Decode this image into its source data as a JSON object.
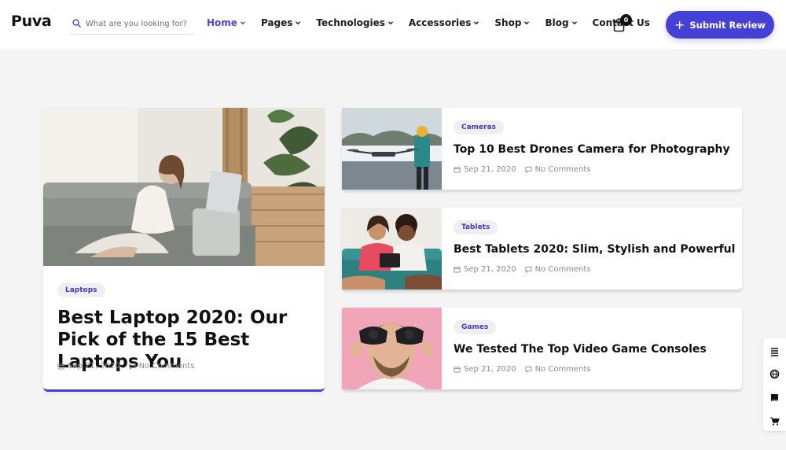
{
  "header": {
    "logo": "Puva",
    "search": {
      "placeholder": "What are you looking for?",
      "value": ""
    },
    "nav": [
      {
        "label": "Home",
        "dropdown": true,
        "active": true
      },
      {
        "label": "Pages",
        "dropdown": true
      },
      {
        "label": "Technologies",
        "dropdown": true
      },
      {
        "label": "Accessories",
        "dropdown": true
      },
      {
        "label": "Shop",
        "dropdown": true
      },
      {
        "label": "Blog",
        "dropdown": true
      },
      {
        "label": "Contact Us",
        "dropdown": false
      }
    ],
    "cart_count": "0",
    "submit_label": "Submit Review"
  },
  "featured": {
    "tag": "Laptops",
    "title": "Best Laptop 2020: Our Pick of the 15 Best Laptops You",
    "date": "Sep 21, 2020",
    "comments": "No Comments"
  },
  "posts": [
    {
      "tag": "Cameras",
      "title": "Top 10 Best Drones Camera for Photography",
      "date": "Sep 21, 2020",
      "comments": "No Comments"
    },
    {
      "tag": "Tablets",
      "title": "Best Tablets 2020: Slim, Stylish and Powerful",
      "date": "Sep 21, 2020",
      "comments": "No Comments"
    },
    {
      "tag": "Games",
      "title": "We Tested The Top Video Game Consoles",
      "date": "Sep 21, 2020",
      "comments": "No Comments"
    }
  ],
  "icons": {
    "search": "search-icon",
    "chevron": "chevron-down-icon",
    "cart": "shopping-bag-icon",
    "plus": "plus-icon",
    "calendar": "calendar-icon",
    "comment": "comment-icon",
    "side_tools": [
      "list-icon",
      "globe-icon",
      "book-icon",
      "cart-icon"
    ]
  },
  "colors": {
    "accent": "#4540d6",
    "tag_bg": "#eeeef3",
    "tag_text": "#3f3cc2",
    "page_bg": "#f4f4f5"
  }
}
